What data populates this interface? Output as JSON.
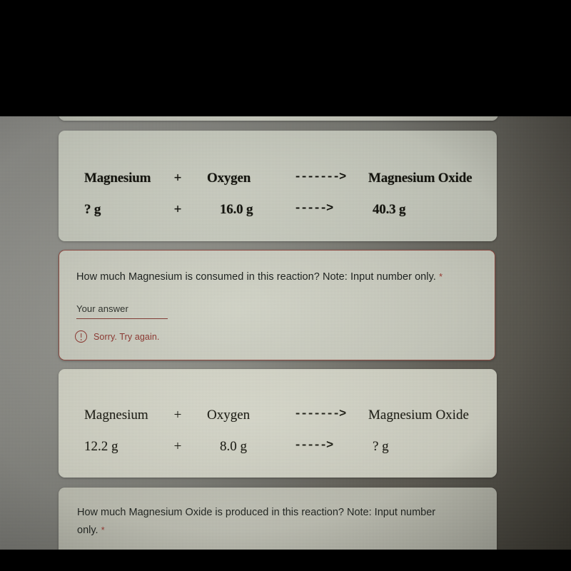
{
  "screenshot": {
    "letterbox_color": "#000000",
    "page_background": "#7b7b76"
  },
  "reaction_card_1": {
    "header_row": {
      "reactant_1": "Magnesium",
      "operator": "+",
      "reactant_2": "Oxygen",
      "arrow": "------->",
      "product": "Magnesium Oxide"
    },
    "value_row": {
      "reactant_1": "? g",
      "operator": "+",
      "reactant_2": "16.0 g",
      "arrow": "----->",
      "product": "40.3 g"
    }
  },
  "question_1": {
    "text": "How much Magnesium is consumed in this reaction? Note: Input number only.",
    "required_marker": "*",
    "answer_label": "Your answer",
    "answer_value": "",
    "answer_placeholder": "Your answer",
    "error_icon": "exclamation-circle-icon",
    "error_text": "Sorry. Try again.",
    "border_color": "#8d4a42",
    "error_color": "#8e3a33"
  },
  "reaction_card_2": {
    "header_row": {
      "reactant_1": "Magnesium",
      "operator": "+",
      "reactant_2": "Oxygen",
      "arrow": "------->",
      "product": "Magnesium Oxide"
    },
    "value_row": {
      "reactant_1": "12.2 g",
      "operator": "+",
      "reactant_2": "8.0 g",
      "arrow": "----->",
      "product": "? g"
    }
  },
  "question_2": {
    "line_1": "How much Magnesium Oxide is produced in this reaction? Note: Input number",
    "line_2": "only.",
    "required_marker": "*"
  }
}
